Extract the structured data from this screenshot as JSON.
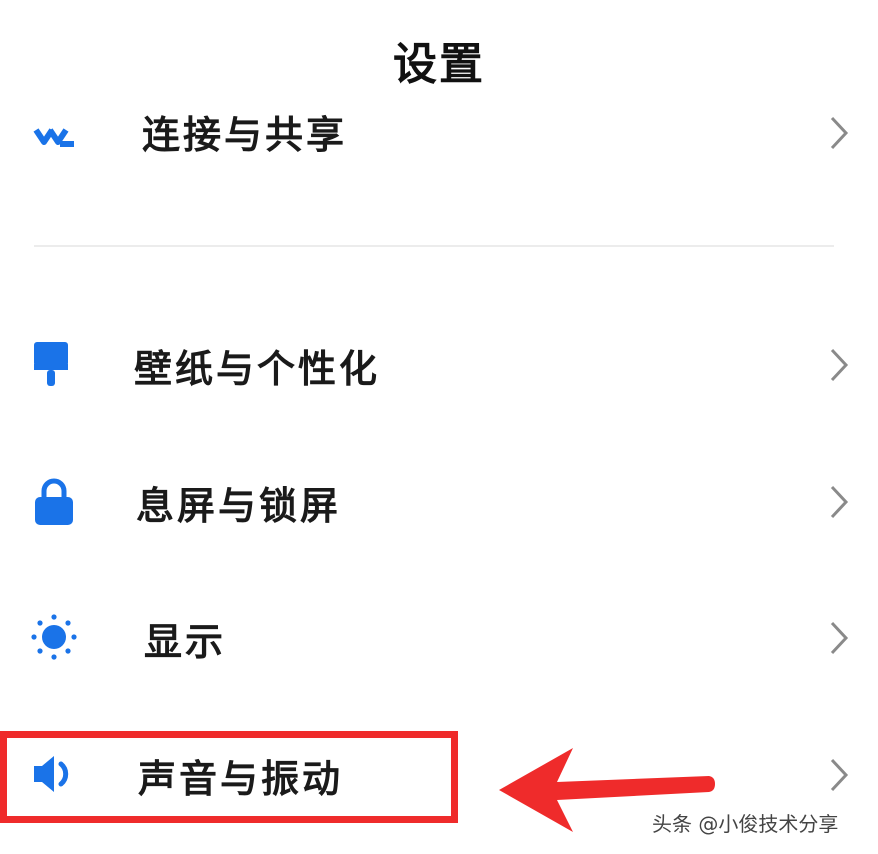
{
  "header": {
    "title": "设置"
  },
  "settings_items": [
    {
      "label": "连接与共享",
      "icon": "connection-share-icon"
    },
    {
      "label": "壁纸与个性化",
      "icon": "paint-brush-icon"
    },
    {
      "label": "息屏与锁屏",
      "icon": "lock-icon"
    },
    {
      "label": "显示",
      "icon": "sun-brightness-icon"
    },
    {
      "label": "声音与振动",
      "icon": "speaker-volume-icon"
    }
  ],
  "annotation": {
    "highlighted_item": "声音与振动",
    "highlight_color": "#ef2b2b"
  },
  "watermark": {
    "text": "头条 @小俊技术分享"
  },
  "colors": {
    "accent": "#1a73e8",
    "chevron": "#8a8a8a"
  }
}
